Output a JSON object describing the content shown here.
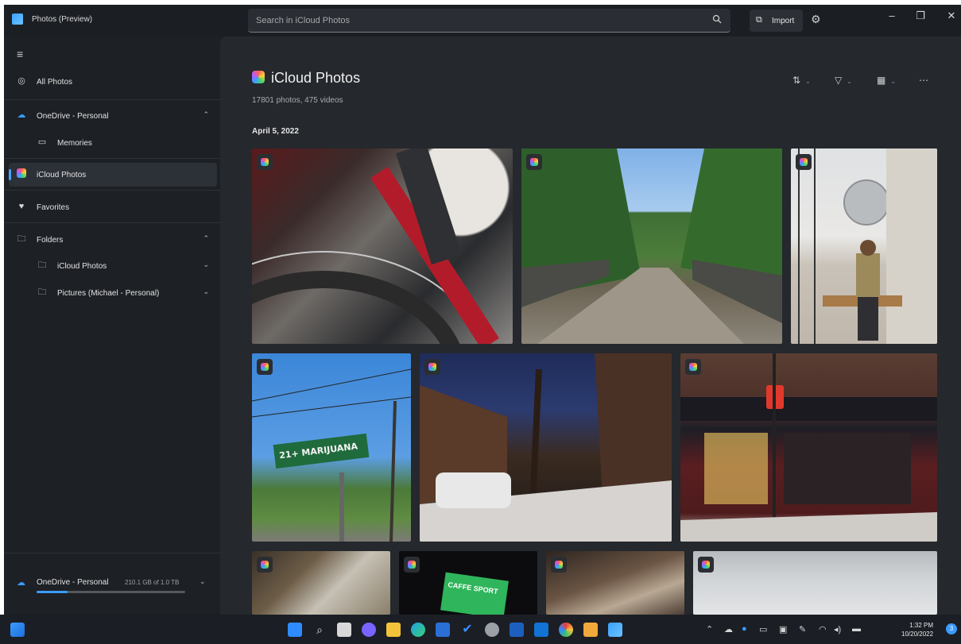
{
  "window": {
    "title": "Photos (Preview)",
    "search_placeholder": "Search in iCloud Photos",
    "import_label": "Import",
    "controls": [
      "minimize",
      "maximize",
      "close"
    ]
  },
  "sidebar": {
    "items": [
      {
        "label": "All Photos",
        "icon": "all-photos-icon"
      },
      {
        "label": "OneDrive - Personal",
        "icon": "cloud-icon",
        "expanded": true
      },
      {
        "label": "Memories",
        "icon": "memories-icon"
      },
      {
        "label": "iCloud Photos",
        "icon": "icloud-icon",
        "selected": true
      },
      {
        "label": "Favorites",
        "icon": "heart-icon"
      },
      {
        "label": "Folders",
        "icon": "folder-icon",
        "expanded": true
      },
      {
        "label": "iCloud Photos",
        "icon": "folder-icon"
      },
      {
        "label": "Pictures (Michael - Personal)",
        "icon": "folder-icon"
      }
    ],
    "quota": {
      "label": "OneDrive - Personal",
      "usage": "210.1 GB of 1.0 TB",
      "fraction": 0.21
    }
  },
  "main": {
    "title": "iCloud Photos",
    "count": "17801 photos, 475 videos",
    "date": "April 5, 2022",
    "toolbar": [
      "sort-icon",
      "filter-icon",
      "view-icon",
      "more-icon"
    ],
    "sign_text": "21+ MARIJUANA",
    "sign_sub": "CAFFE SPORT"
  },
  "taskbar": {
    "time": "1:32 PM",
    "date": "10/20/2022",
    "badge": "3"
  },
  "colors": {
    "accent": "#3a9bff",
    "background": "#1d2025",
    "content": "#25282d"
  }
}
